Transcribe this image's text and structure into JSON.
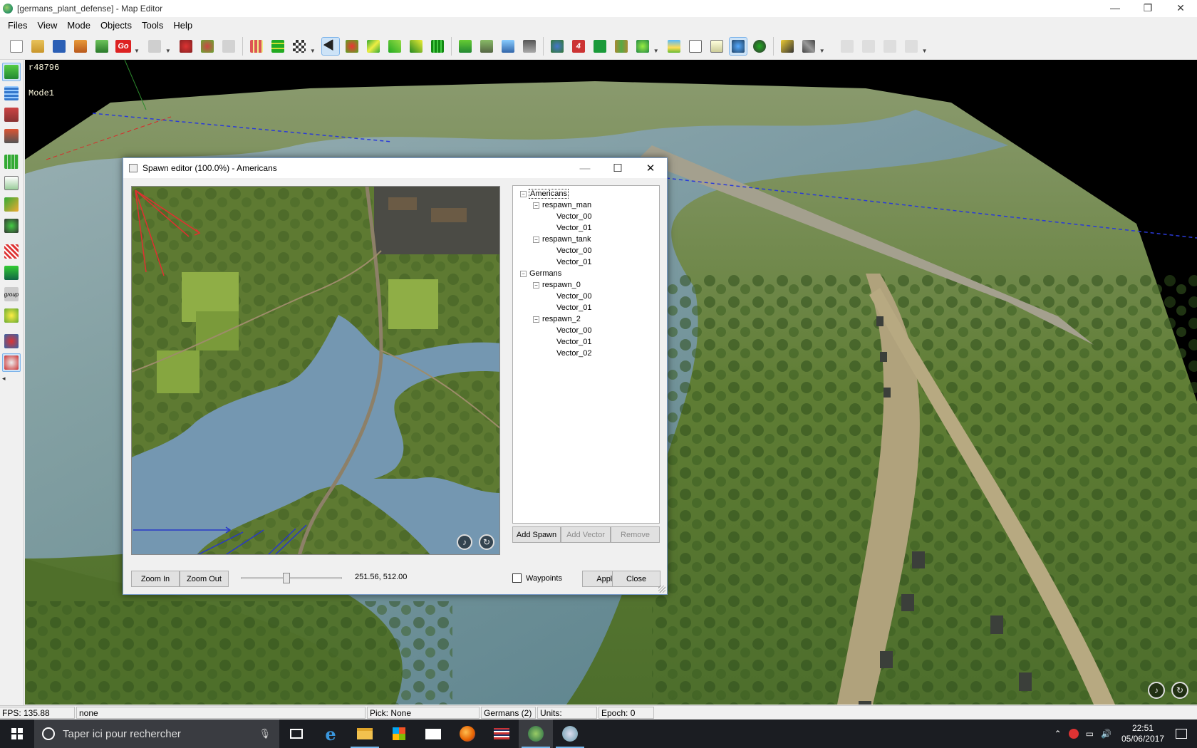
{
  "window": {
    "title": "[germans_plant_defense] - Map Editor",
    "controls": {
      "minimize": "—",
      "restore": "❐",
      "close": "✕"
    }
  },
  "menu": [
    "Files",
    "View",
    "Mode",
    "Objects",
    "Tools",
    "Help"
  ],
  "toolbar": {
    "go_label": "Go",
    "badge_label": "4",
    "accent": "#cde3f7"
  },
  "left_tools": {
    "group_label": "group",
    "collapse_arrow": "◂"
  },
  "viewport": {
    "revision": "r48796",
    "mode": "Mode1"
  },
  "spawn_editor": {
    "title": "Spawn editor (100.0%) - Americans",
    "controls": {
      "minimize": "—",
      "maximize": "☐",
      "close": "✕"
    },
    "tree": [
      {
        "level": 0,
        "label": "Americans",
        "toggle": "⊟",
        "selected": true
      },
      {
        "level": 1,
        "label": "respawn_man",
        "toggle": "⊟"
      },
      {
        "level": 2,
        "label": "Vector_00"
      },
      {
        "level": 2,
        "label": "Vector_01"
      },
      {
        "level": 1,
        "label": "respawn_tank",
        "toggle": "⊟"
      },
      {
        "level": 2,
        "label": "Vector_00"
      },
      {
        "level": 2,
        "label": "Vector_01"
      },
      {
        "level": 0,
        "label": "Germans",
        "toggle": "⊟"
      },
      {
        "level": 1,
        "label": "respawn_0",
        "toggle": "⊟"
      },
      {
        "level": 2,
        "label": "Vector_00"
      },
      {
        "level": 2,
        "label": "Vector_01"
      },
      {
        "level": 1,
        "label": "respawn_2",
        "toggle": "⊟"
      },
      {
        "level": 2,
        "label": "Vector_00"
      },
      {
        "level": 2,
        "label": "Vector_01"
      },
      {
        "level": 2,
        "label": "Vector_02"
      }
    ],
    "buttons": {
      "add_spawn": "Add Spawn",
      "add_vector": "Add Vector",
      "remove": "Remove",
      "zoom_in": "Zoom In",
      "zoom_out": "Zoom Out",
      "apply": "Apply",
      "close": "Close"
    },
    "zoom_slider_fraction": 0.45,
    "coordinates": "251.56, 512.00",
    "waypoints_label": "Waypoints",
    "waypoints_checked": false
  },
  "status": {
    "fps": "FPS: 135.88",
    "selection": "none",
    "pick": "Pick: None",
    "team": "Germans (2)",
    "units": "Units:",
    "epoch": "Epoch: 0"
  },
  "taskbar": {
    "search_placeholder": "Taper ici pour rechercher",
    "time": "22:51",
    "date": "05/06/2017"
  }
}
